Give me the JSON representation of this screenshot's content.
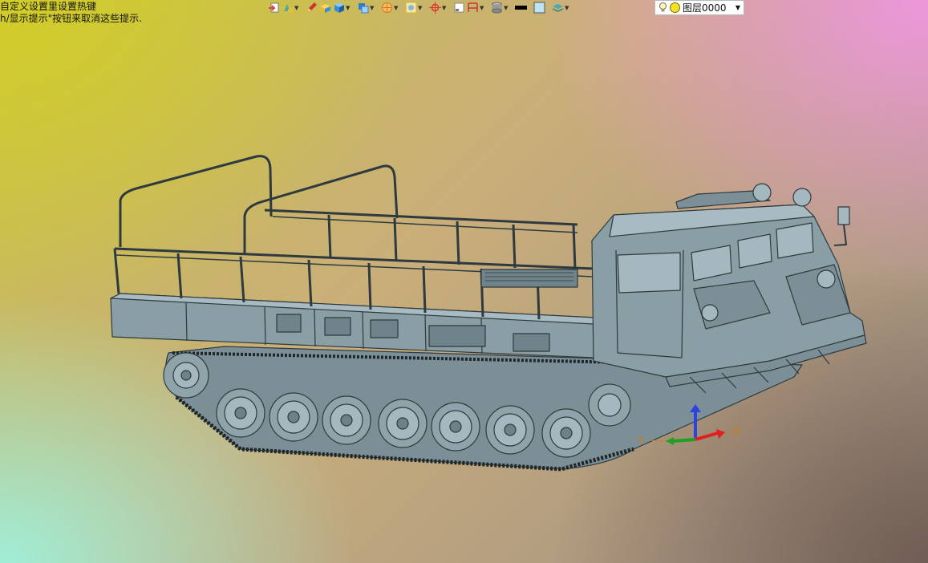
{
  "hints": {
    "line1": "自定义设置里设置热键",
    "line2": "h/显示提示\"按钮来取消这些提示."
  },
  "toolbar": {
    "buttons": [
      {
        "name": "exit-sketch-icon",
        "color": "#d44"
      },
      {
        "name": "color-tool-icon",
        "color": "#5a9"
      },
      {
        "name": "pencil-icon",
        "color": "#c33"
      },
      {
        "name": "block-icon",
        "color": "#e8b830"
      },
      {
        "name": "cube-shaded-icon",
        "color": "#3a8ed8"
      },
      {
        "name": "cube-view-icon",
        "color": "#2f7fd0"
      },
      {
        "name": "orient-icon",
        "color": "#e07020"
      },
      {
        "name": "fit-view-icon",
        "color": "#d8b040"
      },
      {
        "name": "snap-icon",
        "color": "#d33"
      },
      {
        "name": "square-icon",
        "color": "#888"
      },
      {
        "name": "section-icon",
        "color": "#c33"
      },
      {
        "name": "disk-icon",
        "color": "#777"
      },
      {
        "name": "line-color-icon",
        "color": "#000"
      },
      {
        "name": "fill-color-icon",
        "color": "#bde3f5"
      },
      {
        "name": "layers-icon",
        "color": "#4aa8b0"
      }
    ]
  },
  "layer": {
    "label": "图层0000"
  },
  "axes": {
    "x_label": "X",
    "y_label": "Y"
  },
  "colors": {
    "model_fill": "#8a9ea6",
    "model_stroke": "#2e3a3f",
    "axis_z": "#2b44e0",
    "axis_x": "#e02020",
    "axis_y": "#20a020",
    "axis_label": "#d07a10"
  }
}
